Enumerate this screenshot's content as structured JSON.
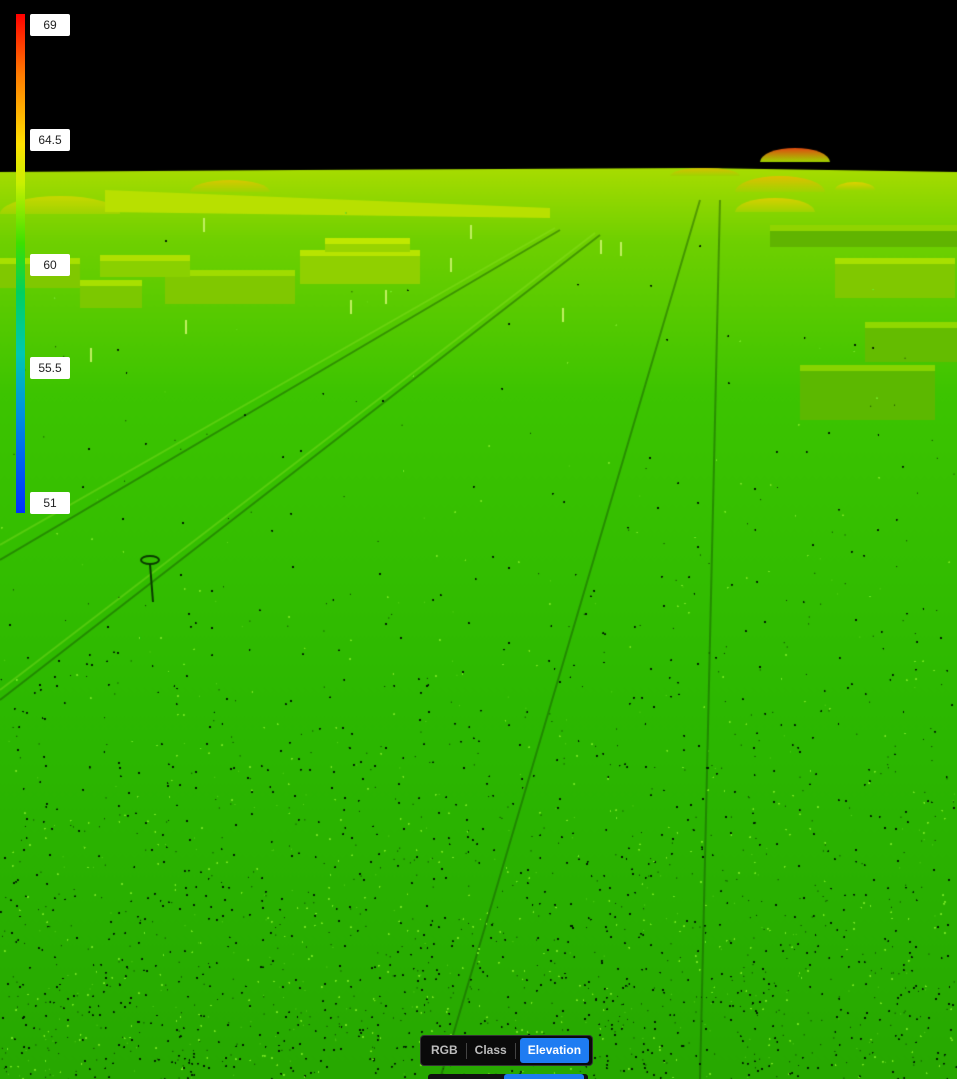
{
  "legend": {
    "labels": [
      "69",
      "64.5",
      "60",
      "55.5",
      "51"
    ],
    "max": 69,
    "min": 51,
    "colors": {
      "high": "#ff0000",
      "upper": "#ffe000",
      "mid": "#3ce000",
      "lower": "#00c8b0",
      "low": "#0030ff"
    }
  },
  "view_modes": {
    "items": [
      "RGB",
      "Class",
      "Elevation"
    ],
    "active": "Elevation",
    "active_color": "#1e7cf2"
  },
  "scene": {
    "background": "#000000",
    "ground_color": "#2bb800",
    "far_color": "#8fdc00",
    "peak_color": "#e05a10"
  }
}
